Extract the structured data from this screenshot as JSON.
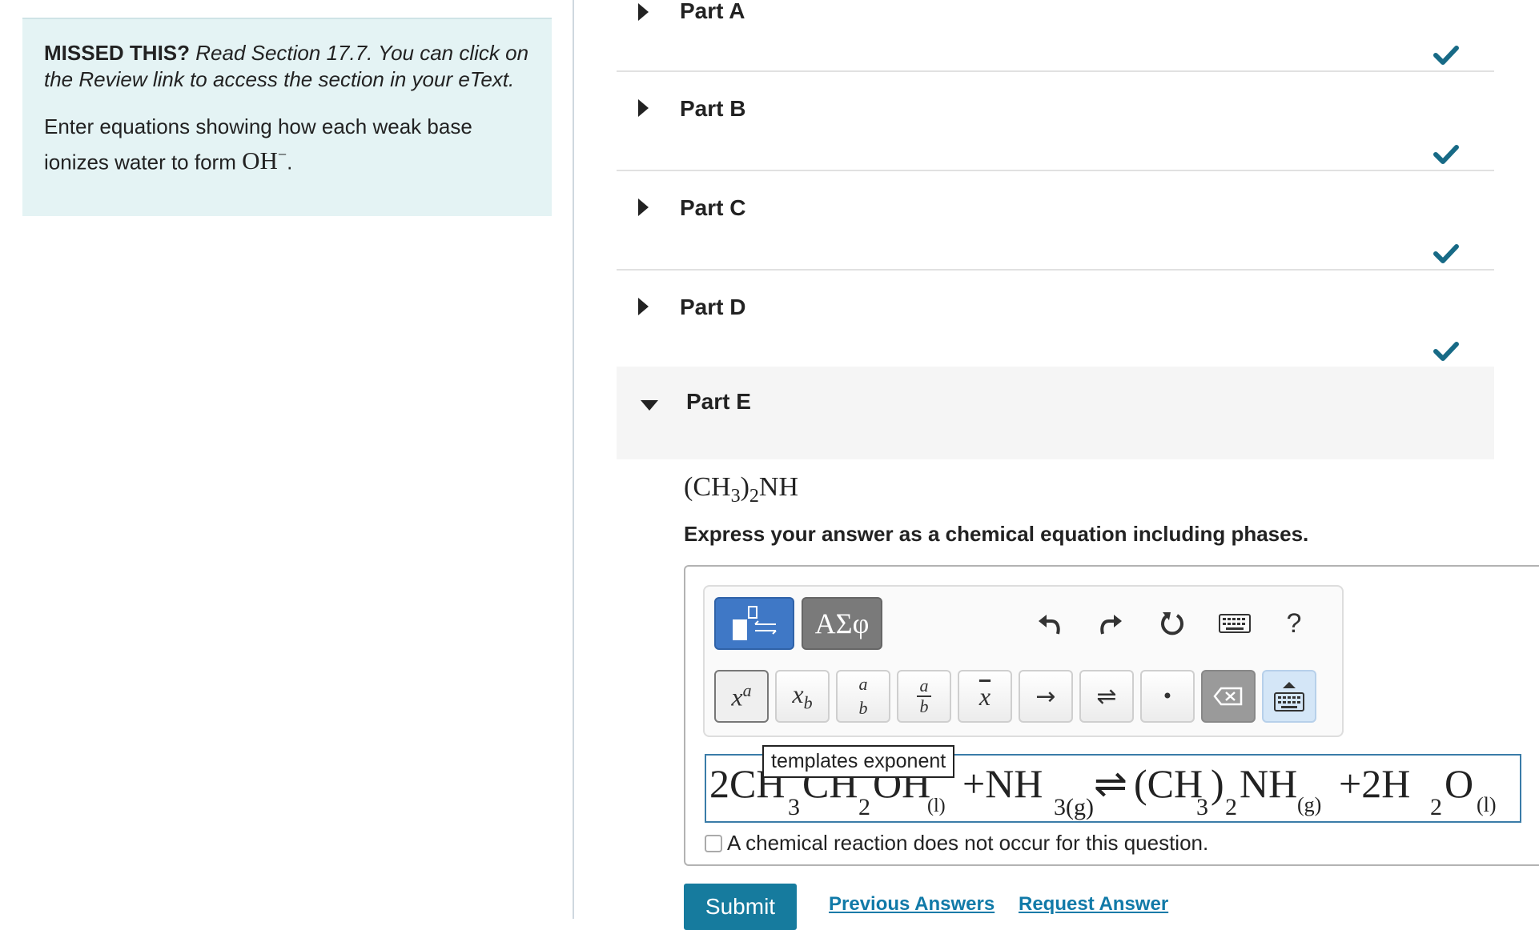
{
  "hint": {
    "bold": "MISSED THIS?",
    "italic": "Read Section 17.7. You can click on the Review link to access the section in your eText.",
    "prompt": "Enter equations showing how each weak base ionizes water to form",
    "ion": "OH",
    "ion_sup": "−",
    "period": "."
  },
  "parts": [
    {
      "label": "Part A",
      "status": "correct"
    },
    {
      "label": "Part B",
      "status": "correct"
    },
    {
      "label": "Part C",
      "status": "correct"
    },
    {
      "label": "Part D",
      "status": "correct"
    }
  ],
  "partE": {
    "label": "Part E",
    "formula_prefix": "(CH",
    "formula_sub1": "3",
    "formula_mid": ")",
    "formula_sub2": "2",
    "formula_suffix": "NH",
    "instruction": "Express your answer as a chemical equation including phases."
  },
  "toolbar": {
    "greek_label": "ΑΣφ",
    "help_label": "?",
    "tooltip": "templates exponent",
    "row2": {
      "sup_base": "x",
      "sup_exp": "a",
      "sub_base": "x",
      "sub_sub": "b",
      "frac_num": "a",
      "frac_den": "b",
      "bar": "x",
      "arrow": "→",
      "equilibrium": "⇌",
      "dot": "•"
    }
  },
  "equation": {
    "text": "2CH3CH2OH(l) + NH3(g) ⇌ (CH3)2NH(g) + 2H2O(l)"
  },
  "no_reaction_label": "A chemical reaction does not occur for this question.",
  "actions": {
    "submit": "Submit",
    "previous": "Previous Answers",
    "request": "Request Answer"
  },
  "colors": {
    "hint_bg": "#e4f3f4",
    "check": "#176a86",
    "submit_bg": "#167b9e",
    "link": "#117aa8",
    "template_btn": "#3f78c6"
  }
}
